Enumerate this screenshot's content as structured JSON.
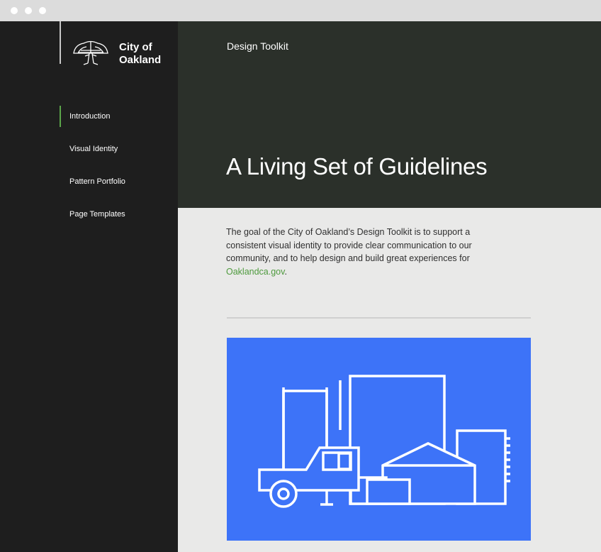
{
  "logo": {
    "line1": "City of",
    "line2": "Oakland"
  },
  "nav": {
    "items": [
      {
        "label": "Introduction",
        "active": true
      },
      {
        "label": "Visual Identity",
        "active": false
      },
      {
        "label": "Pattern Portfolio",
        "active": false
      },
      {
        "label": "Page Templates",
        "active": false
      }
    ]
  },
  "hero": {
    "eyebrow": "Design Toolkit",
    "title": "A Living Set of Guidelines"
  },
  "intro": {
    "text": "The goal of the City of Oakland’s Design Toolkit is to support a consistent visual identity to provide clear communication to our community, and to help design and build great experiences for ",
    "link": "Oaklandca.gov",
    "suffix": "."
  },
  "colors": {
    "sidebar": "#1e1e1e",
    "hero": "#2b302a",
    "accent_green": "#5ba64a",
    "illustration_blue": "#3d73f8"
  }
}
